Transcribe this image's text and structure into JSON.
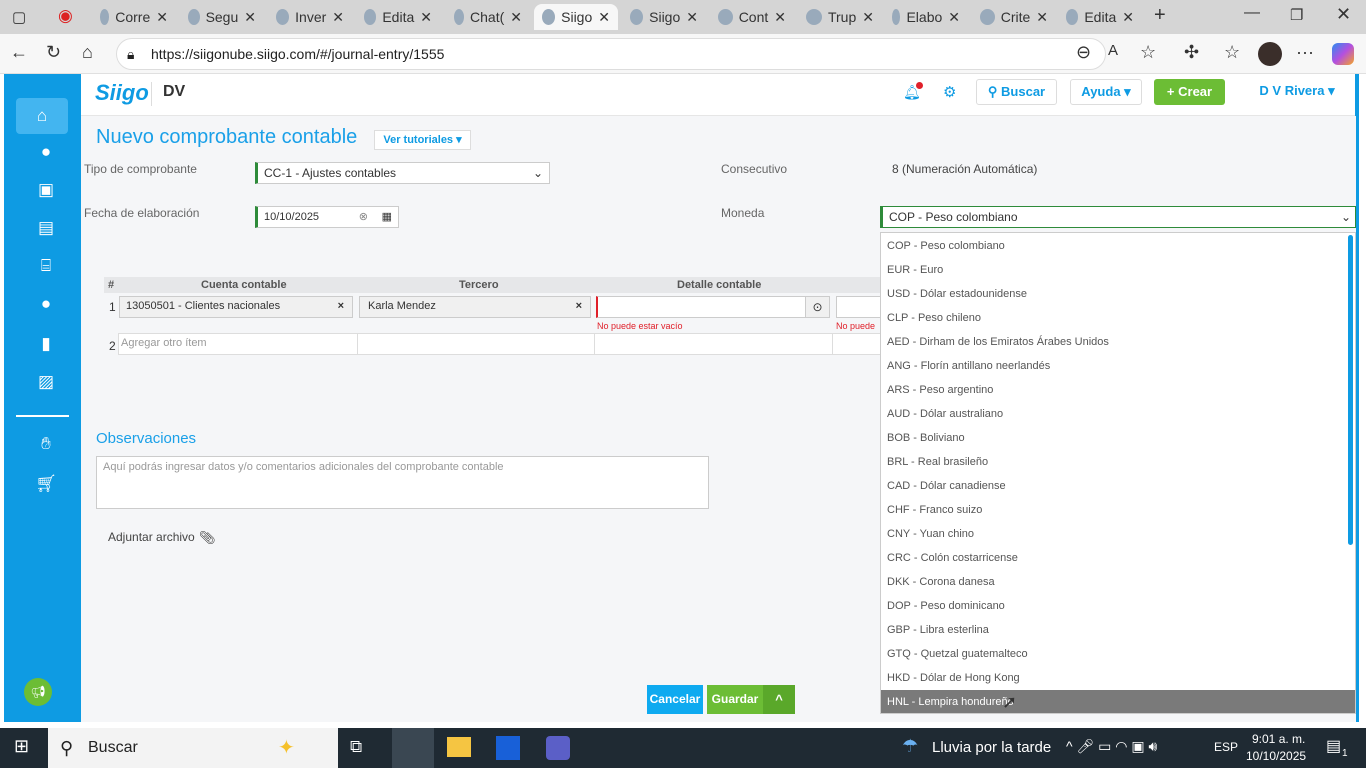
{
  "browser": {
    "tabs": [
      "Corre",
      "Segu",
      "Inver",
      "Edita",
      "Chat(",
      "Siigo",
      "Siigo",
      "Cont",
      "Trup",
      "Elabo",
      "Crite",
      "Edita"
    ],
    "active_tab": 5,
    "url": "https://siigonube.siigo.com/#/journal-entry/1555"
  },
  "header": {
    "logo": "Siigo",
    "company": "DV",
    "search_label": "Buscar",
    "help_label": "Ayuda",
    "create_label": "Crear",
    "user_label": "D V Rivera"
  },
  "page": {
    "title": "Nuevo comprobante contable",
    "tutorials_label": "Ver tutoriales",
    "tipo_label": "Tipo de comprobante",
    "tipo_value": "CC-1 - Ajustes contables",
    "consecutivo_label": "Consecutivo",
    "consecutivo_value": "8 (Numeración Automática)",
    "fecha_label": "Fecha de elaboración",
    "fecha_value": "10/10/2025",
    "moneda_label": "Moneda",
    "moneda_value": "COP - Peso colombiano"
  },
  "table": {
    "headers": [
      "#",
      "Cuenta contable",
      "Tercero",
      "Detalle contable"
    ],
    "row1": {
      "num": "1",
      "cuenta": "13050501 - Clientes nacionales",
      "tercero": "Karla Mendez",
      "error": "No puede estar vacío",
      "error2": "No puede es"
    },
    "row2": {
      "num": "2",
      "placeholder": "Agregar otro ítem"
    }
  },
  "observaciones": {
    "title": "Observaciones",
    "placeholder": "Aquí podrás ingresar datos y/o comentarios adicionales del comprobante contable"
  },
  "attach_label": "Adjuntar archivo",
  "actions": {
    "cancel": "Cancelar",
    "save": "Guardar"
  },
  "currency_options": [
    "COP - Peso colombiano",
    "EUR - Euro",
    "USD - Dólar estadounidense",
    "CLP - Peso chileno",
    "AED - Dirham de los Emiratos Árabes Unidos",
    "ANG - Florín antillano neerlandés",
    "ARS - Peso argentino",
    "AUD - Dólar australiano",
    "BOB - Boliviano",
    "BRL - Real brasileño",
    "CAD - Dólar canadiense",
    "CHF - Franco suizo",
    "CNY - Yuan chino",
    "CRC - Colón costarricense",
    "DKK - Corona danesa",
    "DOP - Peso dominicano",
    "GBP - Libra esterlina",
    "GTQ - Quetzal guatemalteco",
    "HKD - Dólar de Hong Kong",
    "HNL - Lempira hondureño"
  ],
  "highlighted_option": 19,
  "taskbar": {
    "search": "Buscar",
    "weather": "Lluvia por la tarde",
    "lang": "ESP",
    "time": "9:01 a. m.",
    "date": "10/10/2025",
    "notifications": "1"
  },
  "colors": {
    "brand_blue": "#0e9be3",
    "green": "#6cbd35",
    "error": "#e0202a"
  }
}
